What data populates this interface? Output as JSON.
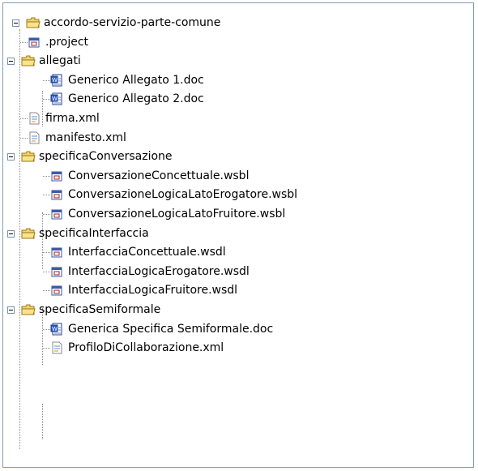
{
  "tree": {
    "root": "accordo-servizio-parte-comune",
    "items": [
      {
        "label": ".project",
        "icon": "project-file-icon"
      },
      {
        "label": "allegati",
        "icon": "folder-icon"
      },
      {
        "label": "Generico Allegato 1.doc",
        "icon": "word-doc-icon"
      },
      {
        "label": "Generico Allegato 2.doc",
        "icon": "word-doc-icon"
      },
      {
        "label": "firma.xml",
        "icon": "xml-file-icon"
      },
      {
        "label": "manifesto.xml",
        "icon": "xml-file-icon"
      },
      {
        "label": "specificaConversazione",
        "icon": "folder-icon"
      },
      {
        "label": "ConversazioneConcettuale.wsbl",
        "icon": "project-file-icon"
      },
      {
        "label": "ConversazioneLogicaLatoErogatore.wsbl",
        "icon": "project-file-icon"
      },
      {
        "label": "ConversazioneLogicaLatoFruitore.wsbl",
        "icon": "project-file-icon"
      },
      {
        "label": "specificaInterfaccia",
        "icon": "folder-icon"
      },
      {
        "label": "InterfacciaConcettuale.wsdl",
        "icon": "project-file-icon"
      },
      {
        "label": "InterfacciaLogicaErogatore.wsdl",
        "icon": "project-file-icon"
      },
      {
        "label": "InterfacciaLogicaFruitore.wsdl",
        "icon": "project-file-icon"
      },
      {
        "label": "specificaSemiformale",
        "icon": "folder-icon"
      },
      {
        "label": "Generica Specifica Semiformale.doc",
        "icon": "word-doc-icon"
      },
      {
        "label": "ProfiloDiCollaborazione.xml",
        "icon": "xml-file-icon"
      }
    ]
  },
  "colors": {
    "border": "#7f9db9",
    "folder": "#f3d36b",
    "line": "#8a8a8a"
  }
}
